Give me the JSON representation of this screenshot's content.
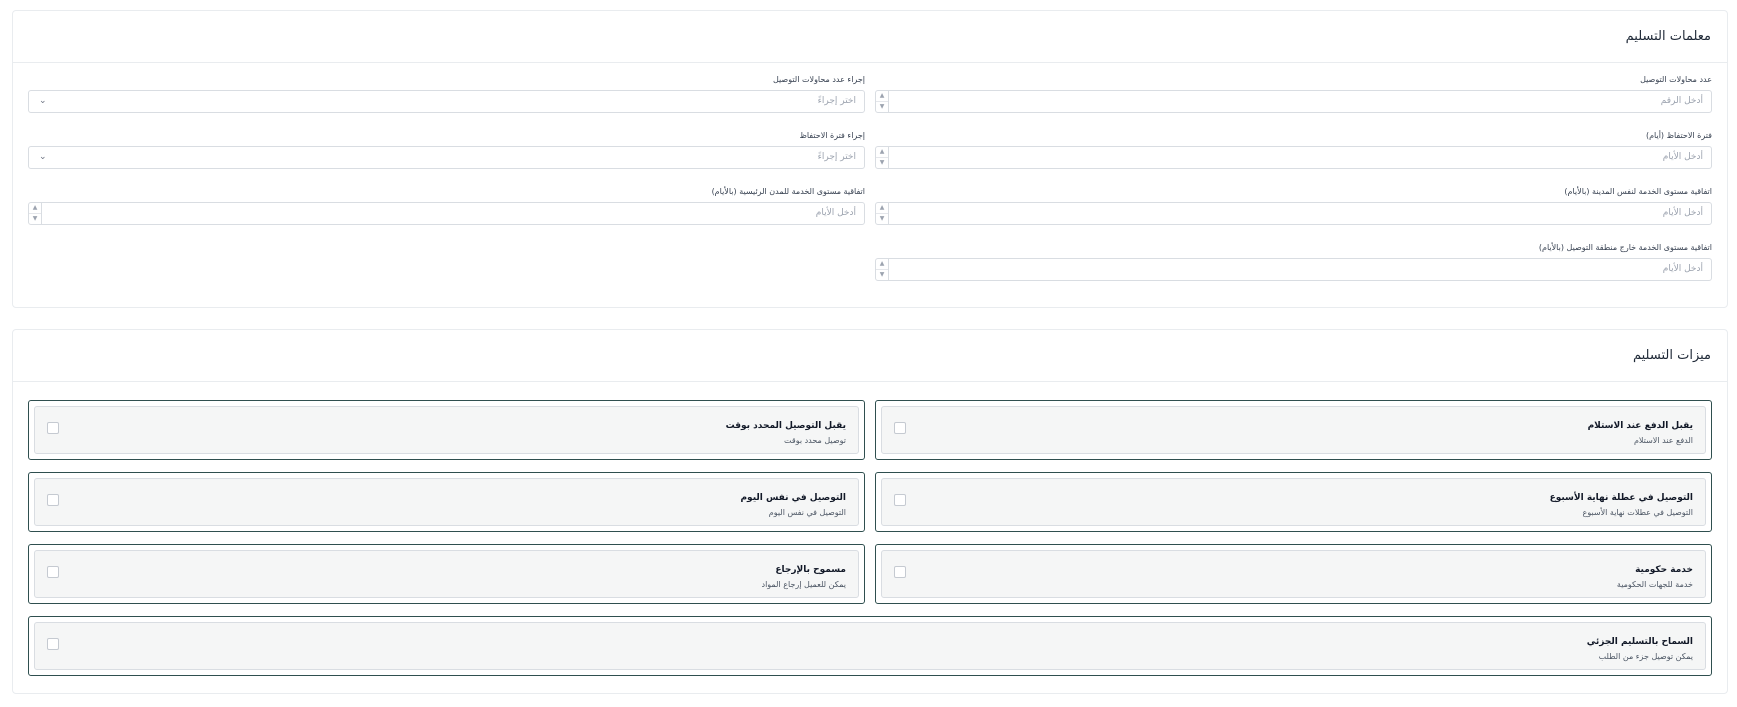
{
  "params": {
    "title": "معلمات التسليم",
    "fields": {
      "attempts_count": {
        "label": "عدد محاولات التوصيل",
        "placeholder": "أدخل الرقم"
      },
      "attempts_action": {
        "label": "إجراء عدد محاولات التوصيل",
        "placeholder": "اختر إجراءً"
      },
      "retention_period": {
        "label": "فترة الاحتفاظ (أيام)",
        "placeholder": "أدخل الأيام"
      },
      "retention_action": {
        "label": "إجراء فترة الاحتفاظ",
        "placeholder": "اختر إجراءً"
      },
      "sla_same_city": {
        "label": "اتفاقية مستوى الخدمة لنفس المدينة (بالأيام)",
        "placeholder": "أدخل الأيام"
      },
      "sla_major_cities": {
        "label": "اتفاقية مستوى الخدمة للمدن الرئيسية (بالأيام)",
        "placeholder": "أدخل الأيام"
      },
      "sla_out_of_zone": {
        "label": "اتفاقية مستوى الخدمة خارج منطقة التوصيل (بالأيام)",
        "placeholder": "أدخل الأيام"
      }
    }
  },
  "features": {
    "title": "ميزات التسليم",
    "items": [
      {
        "title": "يقبل الدفع عند الاستلام",
        "desc": "الدفع عند الاستلام"
      },
      {
        "title": "يقبل التوصيل المحدد بوقت",
        "desc": "توصيل محدد بوقت"
      },
      {
        "title": "التوصيل في عطلة نهاية الأسبوع",
        "desc": "التوصيل في عطلات نهاية الأسبوع"
      },
      {
        "title": "التوصيل في نفس اليوم",
        "desc": "التوصيل في نفس اليوم"
      },
      {
        "title": "خدمة حكومية",
        "desc": "خدمة للجهات الحكومية"
      },
      {
        "title": "مسموح بالإرجاع",
        "desc": "يمكن للعميل إرجاع المواد"
      },
      {
        "title": "السماح بالتسليم الجزئي",
        "desc": "يمكن توصيل جزء من الطلب"
      }
    ]
  },
  "icons": {
    "spin_up": "▲",
    "spin_down": "▼",
    "chevron": "⌄"
  }
}
